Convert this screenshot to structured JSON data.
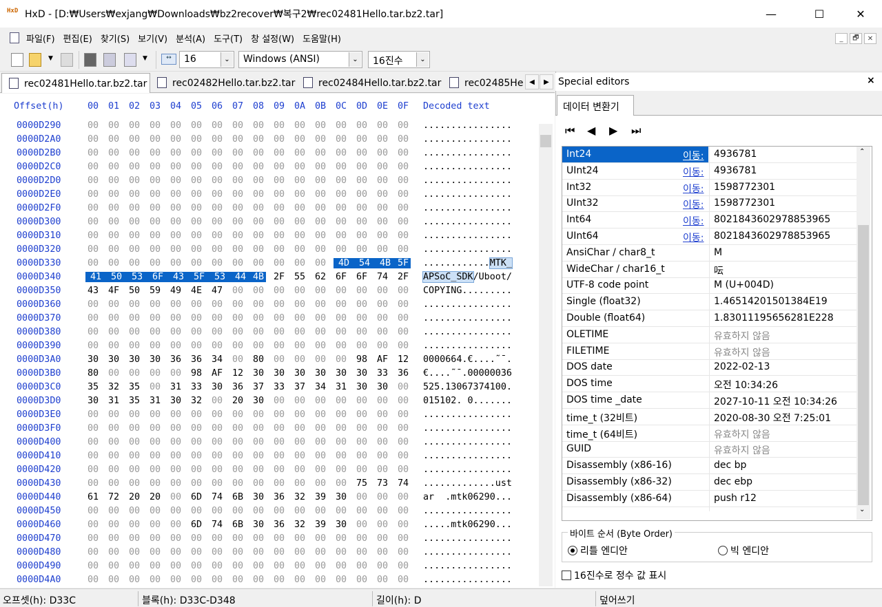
{
  "window": {
    "title": "HxD - [D:₩Users₩exjang₩Downloads₩bz2recover₩복구2₩rec02481Hello.tar.bz2.tar]",
    "min_label": "—",
    "max_label": "☐",
    "close_label": "✕"
  },
  "menu": [
    "파일(F)",
    "편집(E)",
    "찾기(S)",
    "보기(V)",
    "분석(A)",
    "도구(T)",
    "창 설정(W)",
    "도움말(H)"
  ],
  "mdi": {
    "min": "_",
    "restore": "🗗",
    "close": "✕"
  },
  "toolbar": {
    "bytes_per_row": "16",
    "charset": "Windows (ANSI)",
    "offset_base": "16진수"
  },
  "tabs": [
    "rec02481Hello.tar.bz2.tar",
    "rec02482Hello.tar.bz2.tar",
    "rec02484Hello.tar.bz2.tar",
    "rec02485He"
  ],
  "hex": {
    "offset_header": "Offset(h)",
    "column_headers": [
      "00",
      "01",
      "02",
      "03",
      "04",
      "05",
      "06",
      "07",
      "08",
      "09",
      "0A",
      "0B",
      "0C",
      "0D",
      "0E",
      "0F"
    ],
    "decoded_header": "Decoded text",
    "rows": [
      {
        "offset": "0000D290",
        "bytes": "00 00 00 00 00 00 00 00 00 00 00 00 00 00 00 00",
        "text": "................"
      },
      {
        "offset": "0000D2A0",
        "bytes": "00 00 00 00 00 00 00 00 00 00 00 00 00 00 00 00",
        "text": "................"
      },
      {
        "offset": "0000D2B0",
        "bytes": "00 00 00 00 00 00 00 00 00 00 00 00 00 00 00 00",
        "text": "................"
      },
      {
        "offset": "0000D2C0",
        "bytes": "00 00 00 00 00 00 00 00 00 00 00 00 00 00 00 00",
        "text": "................"
      },
      {
        "offset": "0000D2D0",
        "bytes": "00 00 00 00 00 00 00 00 00 00 00 00 00 00 00 00",
        "text": "................"
      },
      {
        "offset": "0000D2E0",
        "bytes": "00 00 00 00 00 00 00 00 00 00 00 00 00 00 00 00",
        "text": "................"
      },
      {
        "offset": "0000D2F0",
        "bytes": "00 00 00 00 00 00 00 00 00 00 00 00 00 00 00 00",
        "text": "................"
      },
      {
        "offset": "0000D300",
        "bytes": "00 00 00 00 00 00 00 00 00 00 00 00 00 00 00 00",
        "text": "................"
      },
      {
        "offset": "0000D310",
        "bytes": "00 00 00 00 00 00 00 00 00 00 00 00 00 00 00 00",
        "text": "................"
      },
      {
        "offset": "0000D320",
        "bytes": "00 00 00 00 00 00 00 00 00 00 00 00 00 00 00 00",
        "text": "................"
      },
      {
        "offset": "0000D330",
        "bytes": "00 00 00 00 00 00 00 00 00 00 00 00 4D 54 4B 5F",
        "text": "............",
        "text_sel": "MTK_",
        "sel_start": 12,
        "sel_end": 15
      },
      {
        "offset": "0000D340",
        "bytes": "41 50 53 6F 43 5F 53 44 4B 2F 55 62 6F 6F 74 2F",
        "text_sel": "APSoC_SDK",
        "text": "/Uboot/",
        "sel_start": 0,
        "sel_end": 8,
        "sel_first": true
      },
      {
        "offset": "0000D350",
        "bytes": "43 4F 50 59 49 4E 47 00 00 00 00 00 00 00 00 00",
        "text": "COPYING........."
      },
      {
        "offset": "0000D360",
        "bytes": "00 00 00 00 00 00 00 00 00 00 00 00 00 00 00 00",
        "text": "................"
      },
      {
        "offset": "0000D370",
        "bytes": "00 00 00 00 00 00 00 00 00 00 00 00 00 00 00 00",
        "text": "................"
      },
      {
        "offset": "0000D380",
        "bytes": "00 00 00 00 00 00 00 00 00 00 00 00 00 00 00 00",
        "text": "................"
      },
      {
        "offset": "0000D390",
        "bytes": "00 00 00 00 00 00 00 00 00 00 00 00 00 00 00 00",
        "text": "................"
      },
      {
        "offset": "0000D3A0",
        "bytes": "30 30 30 30 36 36 34 00 80 00 00 00 00 98 AF 12",
        "text": "0000664.€....˜¯."
      },
      {
        "offset": "0000D3B0",
        "bytes": "80 00 00 00 00 98 AF 12 30 30 30 30 30 30 33 36",
        "text": "€....˜¯.00000036"
      },
      {
        "offset": "0000D3C0",
        "bytes": "35 32 35 00 31 33 30 36 37 33 37 34 31 30 30 00",
        "text": "525.13067374100."
      },
      {
        "offset": "0000D3D0",
        "bytes": "30 31 35 31 30 32 00 20 30 00 00 00 00 00 00 00",
        "text": "015102. 0......."
      },
      {
        "offset": "0000D3E0",
        "bytes": "00 00 00 00 00 00 00 00 00 00 00 00 00 00 00 00",
        "text": "................"
      },
      {
        "offset": "0000D3F0",
        "bytes": "00 00 00 00 00 00 00 00 00 00 00 00 00 00 00 00",
        "text": "................"
      },
      {
        "offset": "0000D400",
        "bytes": "00 00 00 00 00 00 00 00 00 00 00 00 00 00 00 00",
        "text": "................"
      },
      {
        "offset": "0000D410",
        "bytes": "00 00 00 00 00 00 00 00 00 00 00 00 00 00 00 00",
        "text": "................"
      },
      {
        "offset": "0000D420",
        "bytes": "00 00 00 00 00 00 00 00 00 00 00 00 00 00 00 00",
        "text": "................"
      },
      {
        "offset": "0000D430",
        "bytes": "00 00 00 00 00 00 00 00 00 00 00 00 00 75 73 74",
        "text": ".............ust"
      },
      {
        "offset": "0000D440",
        "bytes": "61 72 20 20 00 6D 74 6B 30 36 32 39 30 00 00 00",
        "text": "ar  .mtk06290..."
      },
      {
        "offset": "0000D450",
        "bytes": "00 00 00 00 00 00 00 00 00 00 00 00 00 00 00 00",
        "text": "................"
      },
      {
        "offset": "0000D460",
        "bytes": "00 00 00 00 00 6D 74 6B 30 36 32 39 30 00 00 00",
        "text": ".....mtk06290..."
      },
      {
        "offset": "0000D470",
        "bytes": "00 00 00 00 00 00 00 00 00 00 00 00 00 00 00 00",
        "text": "................"
      },
      {
        "offset": "0000D480",
        "bytes": "00 00 00 00 00 00 00 00 00 00 00 00 00 00 00 00",
        "text": "................"
      },
      {
        "offset": "0000D490",
        "bytes": "00 00 00 00 00 00 00 00 00 00 00 00 00 00 00 00",
        "text": "................"
      },
      {
        "offset": "0000D4A0",
        "bytes": "00 00 00 00 00 00 00 00 00 00 00 00 00 00 00 00",
        "text": "................"
      }
    ]
  },
  "special": {
    "title": "Special editors",
    "close": "×",
    "tab": "데이터 변환기",
    "nav": [
      "⏮",
      "◀",
      "▶",
      "⏭"
    ],
    "link_label": "이동:",
    "rows": [
      {
        "name": "Int24",
        "link": true,
        "value": "4936781",
        "selected": true
      },
      {
        "name": "UInt24",
        "link": true,
        "value": "4936781"
      },
      {
        "name": "Int32",
        "link": true,
        "value": "1598772301"
      },
      {
        "name": "UInt32",
        "link": true,
        "value": "1598772301"
      },
      {
        "name": "Int64",
        "link": true,
        "value": "8021843602978853965"
      },
      {
        "name": "UInt64",
        "link": true,
        "value": "8021843602978853965"
      },
      {
        "name": "AnsiChar / char8_t",
        "value": "M"
      },
      {
        "name": "WideChar / char16_t",
        "value": "呍"
      },
      {
        "name": "UTF-8 code point",
        "value": "M (U+004D)"
      },
      {
        "name": "Single (float32)",
        "value": "1.46514201501384E19"
      },
      {
        "name": "Double (float64)",
        "value": "1.83011195656281E228"
      },
      {
        "name": "OLETIME",
        "value": "유효하지 않음",
        "invalid": true
      },
      {
        "name": "FILETIME",
        "value": "유효하지 않음",
        "invalid": true
      },
      {
        "name": "DOS date",
        "value": "2022-02-13"
      },
      {
        "name": "DOS time",
        "value": "오전 10:34:26"
      },
      {
        "name": "DOS time _date",
        "value": "2027-10-11 오전 10:34:26"
      },
      {
        "name": "time_t (32비트)",
        "value": "2020-08-30 오전 7:25:01"
      },
      {
        "name": "time_t (64비트)",
        "value": "유효하지 않음",
        "invalid": true
      },
      {
        "name": "GUID",
        "value": "유효하지 않음",
        "invalid": true
      },
      {
        "name": "Disassembly (x86-16)",
        "value": "dec bp"
      },
      {
        "name": "Disassembly (x86-32)",
        "value": "dec ebp"
      },
      {
        "name": "Disassembly (x86-64)",
        "value": "push r12"
      }
    ],
    "byte_order_label": "바이트 순서 (Byte Order)",
    "little_endian": "리틀 엔디안",
    "big_endian": "빅 엔디안",
    "hex_int_label": "16진수로 정수 값 표시"
  },
  "status": {
    "offset": "오프셋(h): D33C",
    "block": "블록(h): D33C-D348",
    "length": "길이(h): D",
    "mode": "덮어쓰기"
  }
}
